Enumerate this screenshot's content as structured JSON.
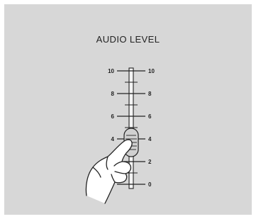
{
  "panel": {
    "title": "AUDIO LEVEL",
    "background_color": "#d7d7d7"
  },
  "scale": {
    "major_labels": [
      "10",
      "8",
      "6",
      "4",
      "2",
      "0"
    ]
  },
  "fader": {
    "knob_level": "4",
    "knob_fill": "#cfcfcf",
    "stroke_color": "#222222"
  },
  "hand": {
    "icon": "pointing-hand-icon"
  }
}
